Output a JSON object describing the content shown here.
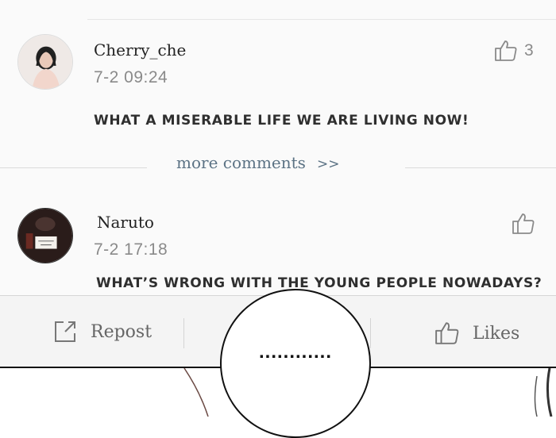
{
  "comments": [
    {
      "username": "Cherry_che",
      "time": "7-2 09:24",
      "likes": "3",
      "text": "WHAT A MISERABLE LIFE WE ARE LIVING NOW!"
    },
    {
      "username": "Naruto",
      "time": "7-2 17:18",
      "likes": "",
      "text": "WHAT’S WRONG WITH THE YOUNG PEOPLE NOWADAYS?"
    }
  ],
  "more_comments": {
    "label": "more comments",
    "arrows": ">>"
  },
  "bottom_bar": {
    "repost_label": "Repost",
    "likes_label": "Likes"
  },
  "speech_bubble": {
    "text": "............"
  },
  "icons": {
    "like": "thumbs-up-icon",
    "repost": "share-icon"
  }
}
